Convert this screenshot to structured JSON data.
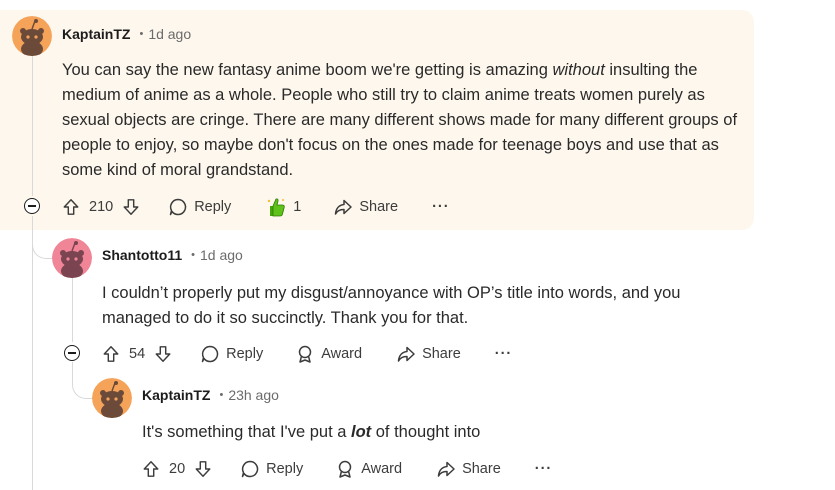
{
  "comments": [
    {
      "author": "KaptainTZ",
      "time": "1d ago",
      "text_parts": [
        "You can say the new fantasy anime boom we're getting is amazing ",
        "without",
        " insulting the medium of anime as a whole. People who still try to claim anime treats women purely as sexual objects are cringe. There are many different shows made for many different groups of people to enjoy, so maybe don't focus on the ones made for teenage boys and use that as some kind of moral grandstand."
      ],
      "votes": "210",
      "reply_label": "Reply",
      "award_count": "1",
      "share_label": "Share",
      "more_label": "···",
      "avatar_color": "#f6a35a",
      "highlighted": true
    },
    {
      "author": "Shantotto11",
      "time": "1d ago",
      "text": "I couldn’t properly put my disgust/annoyance with OP’s title into words, and you managed to do it so succinctly. Thank you for that.",
      "votes": "54",
      "reply_label": "Reply",
      "award_label": "Award",
      "share_label": "Share",
      "more_label": "···",
      "avatar_color": "#f08597"
    },
    {
      "author": "KaptainTZ",
      "time": "23h ago",
      "text_parts": [
        "It's something that I've put a ",
        "lot",
        " of thought into"
      ],
      "votes": "20",
      "reply_label": "Reply",
      "award_label": "Award",
      "share_label": "Share",
      "more_label": "···",
      "avatar_color": "#f6a35a"
    }
  ],
  "colors": {
    "highlight_bg": "#fdf7ed",
    "thread_line": "#d9d9d9",
    "award_green": "#46a508"
  }
}
